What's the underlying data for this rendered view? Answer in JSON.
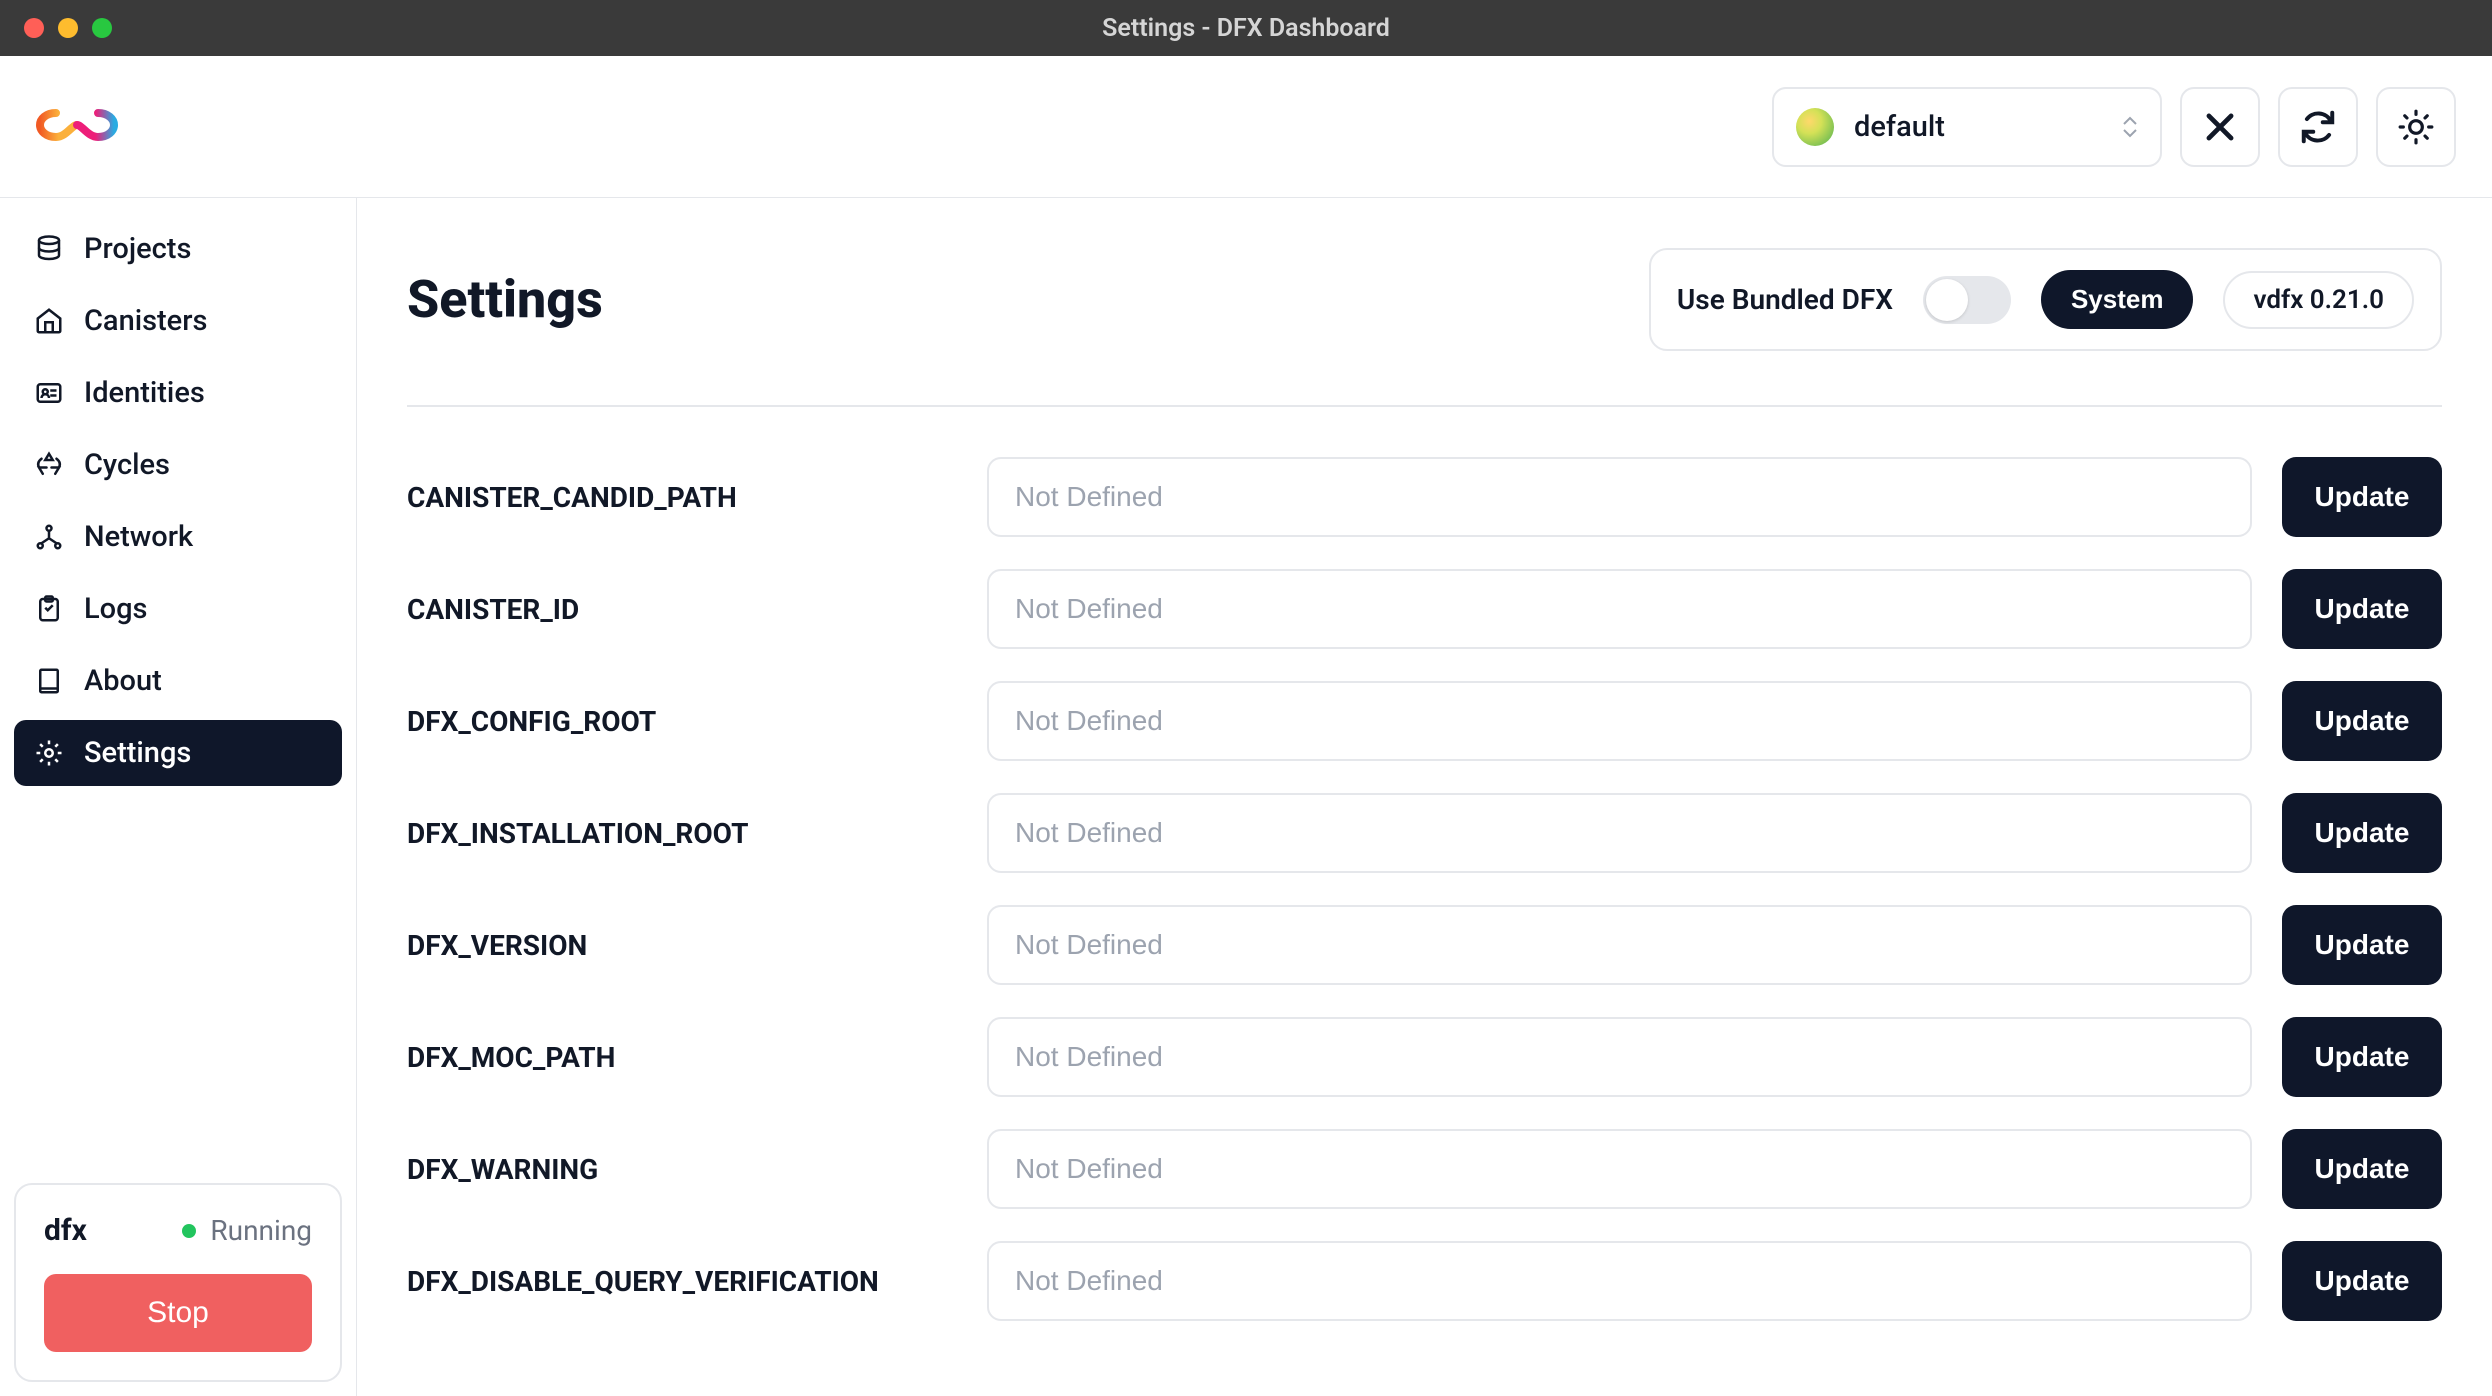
{
  "window": {
    "title": "Settings - DFX Dashboard"
  },
  "header": {
    "identity": "default"
  },
  "sidebar": {
    "items": [
      {
        "label": "Projects"
      },
      {
        "label": "Canisters"
      },
      {
        "label": "Identities"
      },
      {
        "label": "Cycles"
      },
      {
        "label": "Network"
      },
      {
        "label": "Logs"
      },
      {
        "label": "About"
      },
      {
        "label": "Settings"
      }
    ],
    "dfx": {
      "label": "dfx",
      "status_text": "Running",
      "stop_label": "Stop"
    }
  },
  "main": {
    "title": "Settings",
    "bundled_label": "Use Bundled DFX",
    "system_btn": "System",
    "version": "vdfx 0.21.0",
    "rows": [
      {
        "key": "CANISTER_CANDID_PATH",
        "placeholder": "Not Defined",
        "value": "",
        "button": "Update"
      },
      {
        "key": "CANISTER_ID",
        "placeholder": "Not Defined",
        "value": "",
        "button": "Update"
      },
      {
        "key": "DFX_CONFIG_ROOT",
        "placeholder": "Not Defined",
        "value": "",
        "button": "Update"
      },
      {
        "key": "DFX_INSTALLATION_ROOT",
        "placeholder": "Not Defined",
        "value": "",
        "button": "Update"
      },
      {
        "key": "DFX_VERSION",
        "placeholder": "Not Defined",
        "value": "",
        "button": "Update"
      },
      {
        "key": "DFX_MOC_PATH",
        "placeholder": "Not Defined",
        "value": "",
        "button": "Update"
      },
      {
        "key": "DFX_WARNING",
        "placeholder": "Not Defined",
        "value": "",
        "button": "Update"
      },
      {
        "key": "DFX_DISABLE_QUERY_VERIFICATION",
        "placeholder": "Not Defined",
        "value": "",
        "button": "Update"
      }
    ]
  }
}
